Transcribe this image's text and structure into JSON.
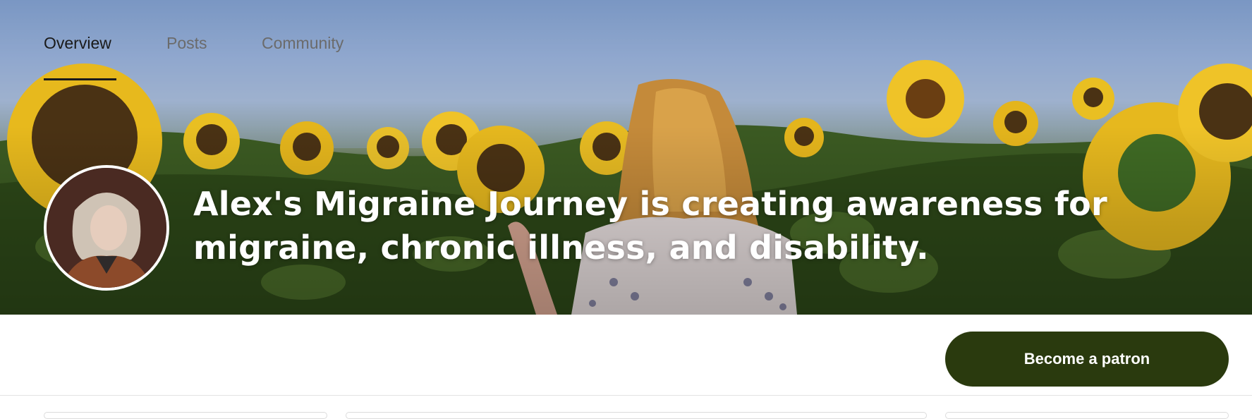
{
  "hero": {
    "headline": "Alex's Migraine Journey is creating awareness for migraine, chronic illness, and disability.",
    "avatar_icon": "creator-avatar",
    "background_image": "sunflower-field-photo"
  },
  "nav": {
    "tabs": [
      {
        "label": "Overview",
        "active": true
      },
      {
        "label": "Posts",
        "active": false
      },
      {
        "label": "Community",
        "active": false
      }
    ]
  },
  "cta": {
    "label": "Become a patron",
    "color": "#2a3a0e"
  }
}
